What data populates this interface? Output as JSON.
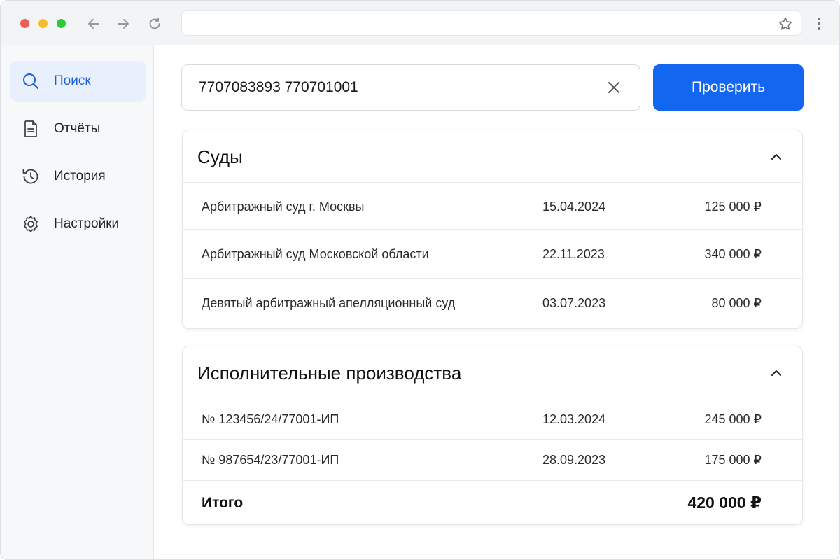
{
  "browser": {
    "address": ""
  },
  "sidebar": {
    "items": [
      {
        "label": "Поиск",
        "icon": "search-icon",
        "active": true
      },
      {
        "label": "Отчёты",
        "icon": "document-icon",
        "active": false
      },
      {
        "label": "История",
        "icon": "history-icon",
        "active": false
      },
      {
        "label": "Настройки",
        "icon": "gear-icon",
        "active": false
      }
    ]
  },
  "search": {
    "value": "7707083893 770701001",
    "button_label": "Проверить"
  },
  "courts": {
    "title": "Суды",
    "rows": [
      {
        "name": "Арбитражный суд г. Москвы",
        "date": "15.04.2024",
        "sum": "125 000 ₽"
      },
      {
        "name": "Арбитражный суд Московской области",
        "date": "22.11.2023",
        "sum": "340 000 ₽"
      },
      {
        "name": "Девятый арбитражный апелляционный суд",
        "date": "03.07.2023",
        "sum": "80 000 ₽"
      }
    ]
  },
  "enforcement": {
    "title": "Исполнительные производства",
    "rows": [
      {
        "name": "№ 123456/24/77001-ИП",
        "date": "12.03.2024",
        "sum": "245 000 ₽"
      },
      {
        "name": "№ 987654/23/77001-ИП",
        "date": "28.09.2023",
        "sum": "175 000 ₽"
      }
    ],
    "total_label": "Итого",
    "total_value": "420 000 ₽"
  },
  "colors": {
    "accent": "#1366f0",
    "active_bg": "#e8f0fd",
    "active_text": "#1b5fd6"
  }
}
